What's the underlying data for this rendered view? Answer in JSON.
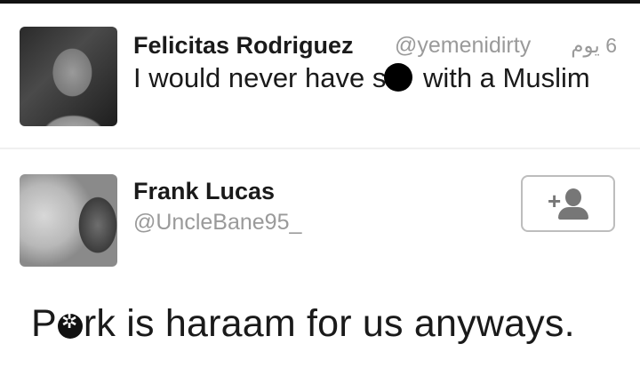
{
  "tweet": {
    "author_name": "Felicitas Rodriguez",
    "author_handle": "@yemenidirty",
    "timestamp": "6 يوم",
    "text_before": "I would never have s",
    "text_after": " with a Muslim"
  },
  "suggested_user": {
    "name": "Frank Lucas",
    "handle": "@UncleBane95_",
    "follow_icon": "add-user-icon"
  },
  "caption": {
    "text_before": "P",
    "text_after": "rk is haraam for us anyways."
  }
}
